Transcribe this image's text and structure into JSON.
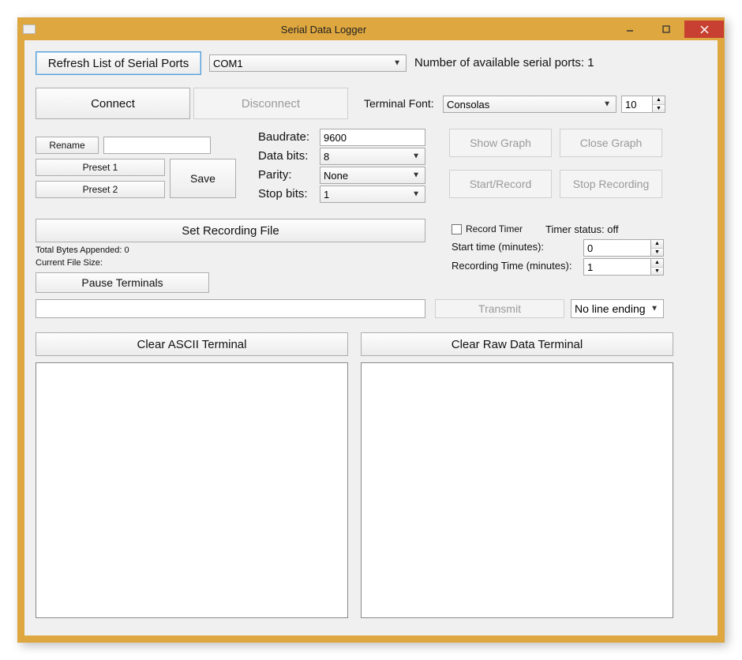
{
  "title": "Serial Data Logger",
  "top": {
    "refresh": "Refresh List of Serial Ports",
    "port": "COM1",
    "available_label": "Number of available serial ports: 1"
  },
  "conn": {
    "connect": "Connect",
    "disconnect": "Disconnect",
    "terminal_font_label": "Terminal Font:",
    "terminal_font": "Consolas",
    "terminal_font_size": "10"
  },
  "presets": {
    "rename": "Rename",
    "rename_value": "",
    "preset1": "Preset 1",
    "preset2": "Preset 2",
    "save": "Save"
  },
  "serial": {
    "baud_label": "Baudrate:",
    "baud": "9600",
    "databits_label": "Data bits:",
    "databits": "8",
    "parity_label": "Parity:",
    "parity": "None",
    "stopbits_label": "Stop bits:",
    "stopbits": "1"
  },
  "graph": {
    "show": "Show Graph",
    "close": "Close Graph",
    "start": "Start/Record",
    "stop": "Stop Recording"
  },
  "recfile": {
    "set": "Set Recording File",
    "total_bytes": "Total Bytes Appended: 0",
    "current_file": "Current File Size:",
    "pause": "Pause Terminals"
  },
  "timer": {
    "record_timer": "Record Timer",
    "status": "Timer status: off",
    "start_label": "Start time (minutes):",
    "start_value": "0",
    "rec_label": "Recording Time (minutes):",
    "rec_value": "1"
  },
  "tx": {
    "value": "",
    "transmit": "Transmit",
    "line_ending": "No line ending"
  },
  "term": {
    "clear_ascii": "Clear ASCII Terminal",
    "clear_raw": "Clear Raw Data Terminal"
  }
}
